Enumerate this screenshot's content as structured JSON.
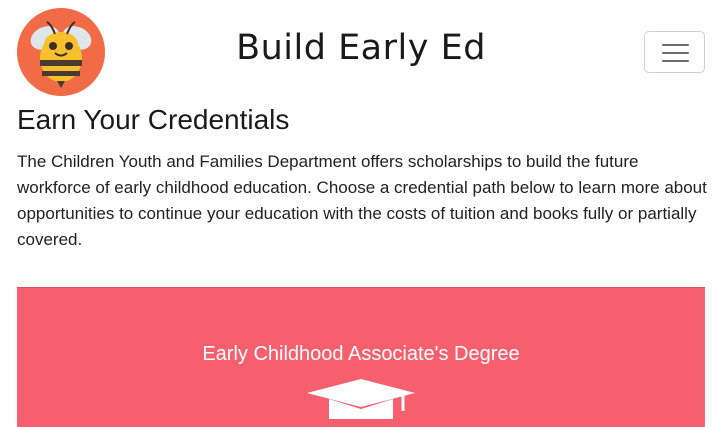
{
  "header": {
    "logo_icon": "bee-icon",
    "site_title": "Build Early Ed",
    "menu_icon": "hamburger-menu-icon"
  },
  "main": {
    "heading": "Earn Your Credentials",
    "intro": "The Children Youth and Families Department offers scholarships to build the future workforce of early childhood education. Choose a credential path below to learn more about opportunities to continue your education with the costs of tuition and books fully or partially covered."
  },
  "credential_card": {
    "title": "Early Childhood Associate's Degree",
    "icon": "graduation-cap-icon",
    "background_color": "#f65f6e"
  }
}
